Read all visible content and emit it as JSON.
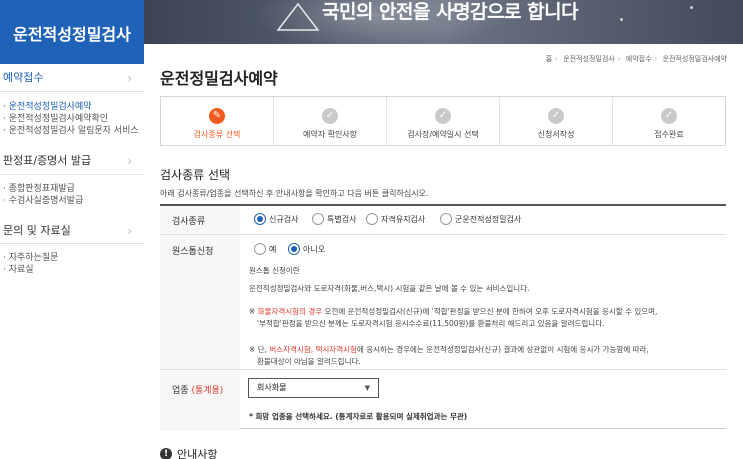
{
  "banner": {
    "slogan": "국민의 안전을 사명감으로 합니다"
  },
  "sidebar": {
    "title": "운전적성정밀검사",
    "sections": [
      {
        "label": "예약접수",
        "active": true,
        "items": [
          "· 운전적성정밀검사예약",
          "· 운전적성정밀검사예약확인",
          "· 운전적성정밀검사 알림문자 서비스"
        ]
      },
      {
        "label": "판정표/증명서 발급",
        "active": false,
        "items": [
          "· 종합판정표재발급",
          "· 수검사실증명서발급"
        ]
      },
      {
        "label": "문의 및 자료실",
        "active": false,
        "items": [
          "· 자주하는질문",
          "· 자료실"
        ]
      }
    ]
  },
  "breadcrumb": [
    "홈",
    "운전적성정밀검사",
    "예약접수",
    "운전적성정밀검사예약"
  ],
  "page_title": "운전정밀검사예약",
  "steps": [
    {
      "label": "검사종류 선택",
      "icon": "pencil-icon",
      "active": true
    },
    {
      "label": "예약자 확인사항",
      "icon": "check-icon",
      "active": false
    },
    {
      "label": "검사장/예약일시 선택",
      "icon": "check-icon",
      "active": false
    },
    {
      "label": "신청서작성",
      "icon": "check-icon",
      "active": false
    },
    {
      "label": "접수완료",
      "icon": "check-icon",
      "active": false
    }
  ],
  "section_title": "검사종류 선택",
  "description": "아래 검사종류/업종을 선택하신 후 안내사항을 확인하고 다음 버튼 클릭하십시오.",
  "form": {
    "exam_type": {
      "label": "검사종류",
      "options": [
        "신규검사",
        "특별검사",
        "자격유지검사",
        "군운전적성정밀검사"
      ],
      "selected": "신규검사"
    },
    "onestop": {
      "label": "원스톱신청",
      "options": [
        "예",
        "아니오"
      ],
      "selected": "아니오",
      "note_title": "원스톱 신청이란",
      "note_body": "운전적성정밀검사와 도로자격(화물,버스,택시) 시험을 같은 날에 볼 수 있는 서비스입니다.",
      "note2_prefix": "※ ",
      "note2_red": "화물자격시험의 경우",
      "note2_line1": " 오전에 운전적성정밀검사(신규)에 '적합'판정을 받으신 분에 한하여 오후 도로자격시험을 응시할 수 있으며,",
      "note2_line2": "'부적합'판정을 받으신 분께는 도로자격시험 응시수수료(11,500원)를 환불처리 해드리고 있음을 알려드립니다.",
      "note3_prefix": "※ 단, ",
      "note3_red": "버스자격시험, 택시자격시험",
      "note3_line1": "에 응시하는 경우에는 운전적성정밀검사(신규) 결과에 상관없이 시험에 응시가 가능함에 따라,",
      "note3_line2": "환불대상이 아님을 알려드립니다."
    },
    "industry": {
      "label": "업종",
      "label_red": "(통계용)",
      "value": "회사화물",
      "hint": "* 희망 업종을 선택하세요. (통계자료로 활용되며 실제취업과는 무관)"
    }
  },
  "guide_title": "안내사항",
  "colors": {
    "brand": "#1f62b8",
    "step_active": "#f25a1e",
    "warning": "#e03a2f"
  }
}
